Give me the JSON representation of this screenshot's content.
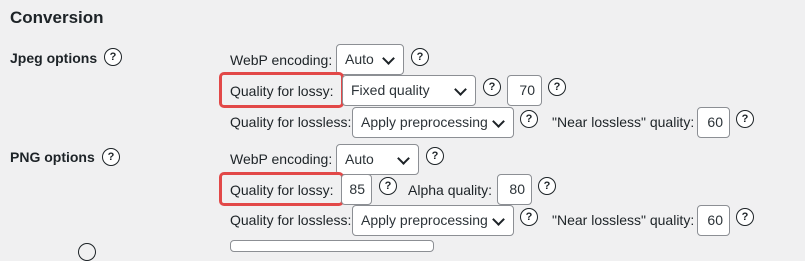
{
  "section": {
    "title": "Conversion"
  },
  "jpeg": {
    "label": "Jpeg options",
    "webp_encoding_label": "WebP encoding:",
    "webp_encoding_value": "Auto",
    "lossy_label": "Quality for lossy:",
    "lossy_value": "Fixed quality",
    "lossy_quality": "70",
    "lossless_label": "Quality for lossless:",
    "lossless_value": "Apply preprocessing",
    "near_lossless_label": "\"Near lossless\" quality:",
    "near_lossless_value": "60"
  },
  "png": {
    "label": "PNG options",
    "webp_encoding_label": "WebP encoding:",
    "webp_encoding_value": "Auto",
    "lossy_label": "Quality for lossy:",
    "lossy_quality": "85",
    "alpha_label": "Alpha quality:",
    "alpha_value": "80",
    "lossless_label": "Quality for lossless:",
    "lossless_value": "Apply preprocessing",
    "near_lossless_label": "\"Near lossless\" quality:",
    "near_lossless_value": "60"
  },
  "help_glyph": "?",
  "colors": {
    "highlight": "#e24848",
    "background": "#f0f0f1"
  }
}
